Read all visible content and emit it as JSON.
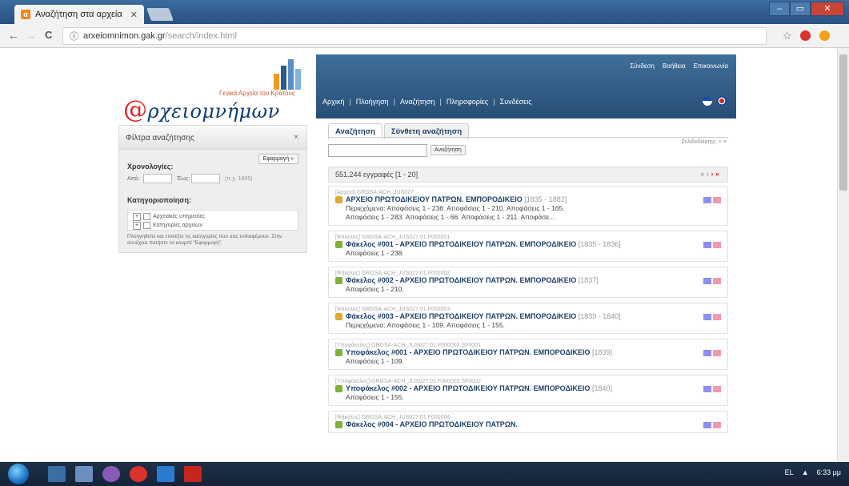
{
  "browser": {
    "tab_title": "Αναζήτηση στα αρχεία",
    "tab_close": "✕",
    "url_host": "arxeiomnimon.gak.gr",
    "url_path": "/search/index.html",
    "nav_back": "←",
    "nav_forward": "→",
    "nav_reload": "C",
    "secure_icon": "ⓘ",
    "star_icon": "☆",
    "window_controls": [
      "–",
      "▭",
      "✕"
    ]
  },
  "logo": {
    "tagline": "Γενικά Αρχεία του Κράτους",
    "at_sign": "@",
    "name": "ρχειομνήμων"
  },
  "header": {
    "user_links": [
      "Σύνδεση",
      "Βοήθεια",
      "Επικοινωνία"
    ],
    "nav": [
      "Αρχική",
      "Πλοήγηση",
      "Αναζήτηση",
      "Πληροφορίες",
      "Συνδέσεις"
    ],
    "separator": "|"
  },
  "filters": {
    "title": "Φίλτρα αναζήτησης",
    "close": "×",
    "apply": "Εφαρμογή »",
    "dates_label": "Χρονολογίες:",
    "from_label": "Από:",
    "to_label": "Έως:",
    "year_hint": "(π.χ. 1865)",
    "categories_label": "Κατηγοριοποίηση:",
    "tree_items": [
      "Αρχειακές υπηρεσίες",
      "Κατηγορίες αρχείων"
    ],
    "help_text": "Πλοηγηθείτε και επιλέξτε τις κατηγορίες που σας ενδιαφέρουν. Στην συνέχεια πατήστε το κουμπί \"Εφαρμογή\"."
  },
  "search": {
    "tabs": [
      "Αναζήτηση",
      "Σύνθετη αναζήτηση"
    ],
    "bookmarks_label": "Σελιδοδείκτης: + ×",
    "button": "Αναζήτηση",
    "results_count": "551.244 εγγραφές [1 - 20]",
    "pager": [
      "«",
      "‹",
      "›",
      "»"
    ]
  },
  "records": [
    {
      "meta": "[Αρχείο] GRGSA-ACH_JUS027",
      "title": "ΑΡΧΕΙΟ ΠΡΩΤΟΔΙΚΕΙΟΥ ΠΑΤΡΩΝ. ΕΜΠΟΡΟΔΙΚΕΙΟ",
      "dates": "[1835 - 1882]",
      "lines": [
        "Περιεχόμενα: Αποφάσεις 1 - 238. Αποφάσεις 1 - 210. Αποφάσεις 1 - 165.",
        "Αποφάσεις 1 - 283. Αποφάσεις 1 - 66. Αποφάσεις 1 - 211. Αποφάσε..."
      ],
      "icon_color": "#e2a72e"
    },
    {
      "meta": "[Φάκελος] GRGSA-ACH_JUS027.01.F000001",
      "title": "Φάκελος #001 - ΑΡΧΕΙΟ ΠΡΩΤΟΔΙΚΕΙΟΥ ΠΑΤΡΩΝ. ΕΜΠΟΡΟΔΙΚΕΙΟ",
      "dates": "[1835 - 1836]",
      "lines": [
        "Αποφάσεις 1 - 238."
      ],
      "icon_color": "#7fb23a"
    },
    {
      "meta": "[Φάκελος] GRGSA-ACH_JUS027.01.F000002",
      "title": "Φάκελος #002 - ΑΡΧΕΙΟ ΠΡΩΤΟΔΙΚΕΙΟΥ ΠΑΤΡΩΝ. ΕΜΠΟΡΟΔΙΚΕΙΟ",
      "dates": "[1837]",
      "lines": [
        "Αποφάσεις 1 - 210."
      ],
      "icon_color": "#7fb23a"
    },
    {
      "meta": "[Φάκελος] GRGSA-ACH_JUS027.01.F000003",
      "title": "Φάκελος #003 - ΑΡΧΕΙΟ ΠΡΩΤΟΔΙΚΕΙΟΥ ΠΑΤΡΩΝ. ΕΜΠΟΡΟΔΙΚΕΙΟ",
      "dates": "[1839 - 1840]",
      "lines": [
        "Περιεχόμενα: Αποφάσεις 1 - 109. Αποφάσεις 1 - 155."
      ],
      "icon_color": "#e2a72e"
    },
    {
      "meta": "[Υποφάκελος] GRGSA-ACH_JUS027.01.F000003.SF0001",
      "title": "Υποφάκελος #001 - ΑΡΧΕΙΟ ΠΡΩΤΟΔΙΚΕΙΟΥ ΠΑΤΡΩΝ. ΕΜΠΟΡΟΔΙΚΕΙΟ",
      "dates": "[1839]",
      "lines": [
        "Αποφάσεις 1 - 109."
      ],
      "icon_color": "#7fb23a"
    },
    {
      "meta": "[Υποφάκελος] GRGSA-ACH_JUS027.01.F000003.SF0002",
      "title": "Υποφάκελος #002 - ΑΡΧΕΙΟ ΠΡΩΤΟΔΙΚΕΙΟΥ ΠΑΤΡΩΝ. ΕΜΠΟΡΟΔΙΚΕΙΟ",
      "dates": "[1840]",
      "lines": [
        "Αποφάσεις 1 - 155."
      ],
      "icon_color": "#7fb23a"
    },
    {
      "meta": "[Φάκελος] GRGSA-ACH_JUS027.01.F000004",
      "title": "Φάκελος #004 - ΑΡΧΕΙΟ ΠΡΩΤΟΔΙΚΕΙΟΥ ΠΑΤΡΩΝ.",
      "dates": "",
      "lines": [],
      "icon_color": "#7fb23a"
    }
  ],
  "taskbar": {
    "tray_text": "EL",
    "time": "6:33 μμ"
  },
  "colors": {
    "header_blue": "#2e5982",
    "link_blue": "#1b3f66",
    "logo_red": "#e02424"
  }
}
